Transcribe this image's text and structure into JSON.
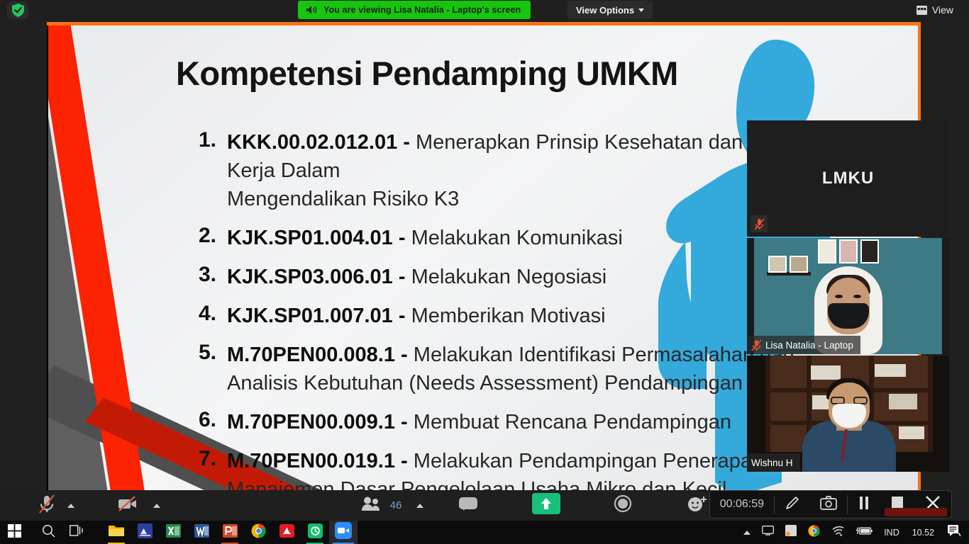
{
  "topbar": {
    "security_icon": "shield-check-icon",
    "banner_icon": "speaker-icon",
    "banner_text": "You are viewing Lisa Natalia - Laptop's screen",
    "view_options_label": "View Options",
    "view_options_caret": "chevron-down-icon",
    "view_button_label": "View",
    "view_button_icon": "grid-view-icon",
    "banner_color": "#16c60c"
  },
  "slide": {
    "title": "Kompetensi Pendamping UMKM",
    "items": [
      {
        "num": "1.",
        "code": "KKK.00.02.012.01",
        "dash": "-",
        "text": "Menerapkan Prinsip Kesehatan dan Keselamatan Kerja Dalam",
        "line2": "Mengendalikan Risiko K3"
      },
      {
        "num": "2.",
        "code": "KJK.SP01.004.01",
        "dash": "-",
        "text": "Melakukan Komunikasi",
        "line2": ""
      },
      {
        "num": "3.",
        "code": "KJK.SP03.006.01",
        "dash": "-",
        "text": "Melakukan Negosiasi",
        "line2": ""
      },
      {
        "num": "4.",
        "code": "KJK.SP01.007.01",
        "dash": "-",
        "text": "Memberikan Motivasi",
        "line2": ""
      },
      {
        "num": "5.",
        "code": "M.70PEN00.008.1",
        "dash": "-",
        "text": "Melakukan Identifikasi Permasalahan dan",
        "line2": "Analisis Kebutuhan (Needs Assessment) Pendampingan"
      },
      {
        "num": "6.",
        "code": "M.70PEN00.009.1",
        "dash": "-",
        "text": "Membuat Rencana Pendampingan",
        "line2": ""
      },
      {
        "num": "7.",
        "code": "M.70PEN00.019.1",
        "dash": "-",
        "text": "Melakukan Pendampingan Penerapan",
        "line2": "Manajemen Dasar Pengelolaan Usaha Mikro dan Kecil"
      }
    ],
    "accent_red": "#fb2301",
    "accent_gray": "#5f5f5f",
    "accent_blue": "#33a9dc",
    "border_orange": "#f97316"
  },
  "participants": [
    {
      "name": "LMKU",
      "label": "",
      "muted": true,
      "active": false,
      "type": "name-only"
    },
    {
      "name": "Lisa Natalia - Laptop",
      "label": "Lisa Natalia - Laptop",
      "muted": true,
      "active": false,
      "type": "video"
    },
    {
      "name": "Wishnu H",
      "label": "Wishnu H",
      "muted": false,
      "active": true,
      "type": "video"
    }
  ],
  "controls": {
    "mute_icon": "microphone-muted-icon",
    "mute_caret": "chevron-up-icon",
    "video_icon": "camera-muted-icon",
    "video_caret": "chevron-up-icon",
    "participants_icon": "participants-icon",
    "participants_count": "46",
    "participants_caret": "chevron-up-icon",
    "chat_icon": "chat-icon",
    "share_icon": "share-screen-icon",
    "record_icon": "record-icon",
    "reactions_icon": "reactions-icon",
    "share_color": "#18c07a"
  },
  "recording_toolbar": {
    "timer": "00:06:59",
    "annotate_icon": "pencil-icon",
    "screenshot_icon": "camera-icon",
    "pause_icon": "pause-icon",
    "stop_icon": "stop-icon",
    "close_icon": "close-icon"
  },
  "taskbar": {
    "items": [
      {
        "icon": "windows-start-icon",
        "name": "start-button"
      },
      {
        "icon": "search-icon",
        "name": "search-button"
      },
      {
        "icon": "task-view-icon",
        "name": "task-view-button"
      },
      {
        "icon": "file-explorer-icon",
        "name": "file-explorer"
      },
      {
        "icon": "blue-app-icon",
        "name": "app-blue"
      },
      {
        "icon": "excel-icon",
        "name": "excel"
      },
      {
        "icon": "word-icon",
        "name": "word"
      },
      {
        "icon": "powerpoint-icon",
        "name": "powerpoint"
      },
      {
        "icon": "chrome-icon",
        "name": "chrome"
      },
      {
        "icon": "adobe-reader-icon",
        "name": "adobe-reader"
      },
      {
        "icon": "green-app-icon",
        "name": "app-green"
      },
      {
        "icon": "zoom-icon",
        "name": "zoom"
      }
    ],
    "tray": {
      "overflow_icon": "chevron-up-icon",
      "display_icon": "display-icon",
      "app-tray-icon": "tray-app-icon",
      "chrome_icon": "chrome-icon",
      "wifi_icon": "wifi-icon",
      "battery_icon": "battery-charging-icon",
      "language": "IND",
      "clock": "10.52",
      "notification_icon": "notifications-icon"
    }
  }
}
